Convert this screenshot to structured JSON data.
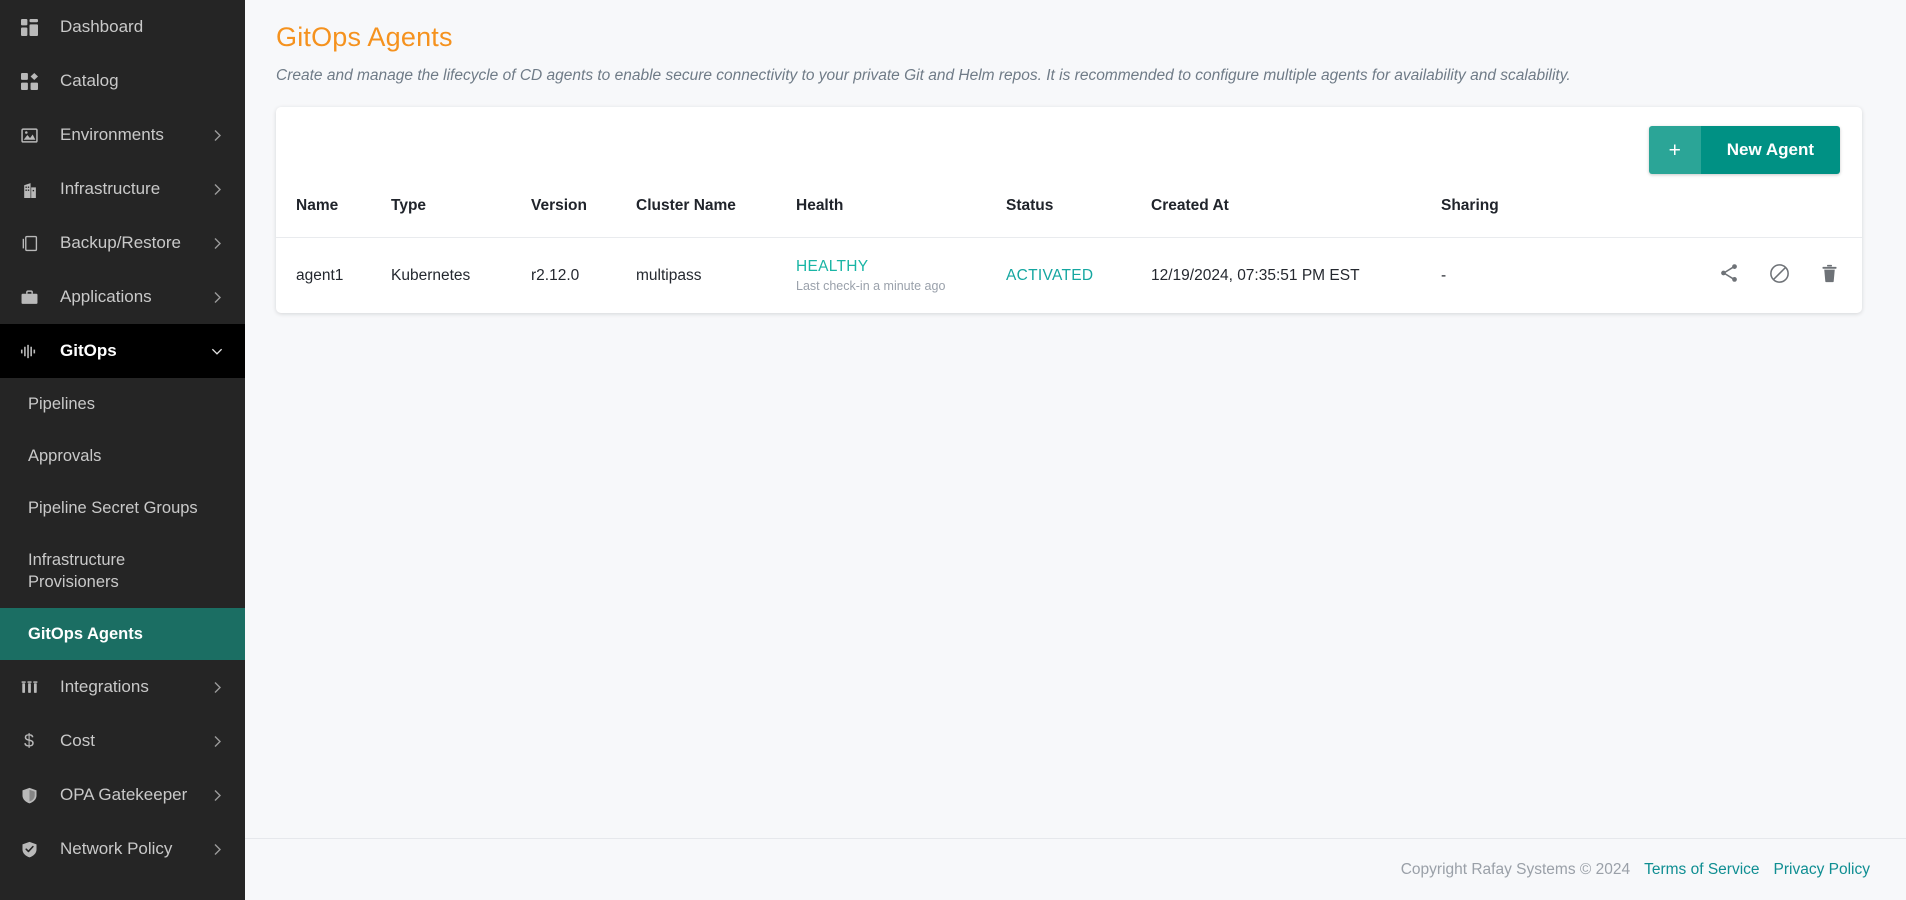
{
  "sidebar": {
    "items": [
      {
        "label": "Dashboard",
        "icon": "dashboard-icon",
        "has_chevron": false,
        "active": false
      },
      {
        "label": "Catalog",
        "icon": "catalog-icon",
        "has_chevron": false,
        "active": false
      },
      {
        "label": "Environments",
        "icon": "environments-icon",
        "has_chevron": true,
        "active": false
      },
      {
        "label": "Infrastructure",
        "icon": "infrastructure-icon",
        "has_chevron": true,
        "active": false
      },
      {
        "label": "Backup/Restore",
        "icon": "backup-restore-icon",
        "has_chevron": true,
        "active": false
      },
      {
        "label": "Applications",
        "icon": "applications-icon",
        "has_chevron": true,
        "active": false
      },
      {
        "label": "GitOps",
        "icon": "gitops-icon",
        "has_chevron": true,
        "active": true
      }
    ],
    "gitops_children": [
      {
        "label": "Pipelines",
        "active": false
      },
      {
        "label": "Approvals",
        "active": false
      },
      {
        "label": "Pipeline Secret Groups",
        "active": false
      },
      {
        "label": "Infrastructure Provisioners",
        "active": false
      },
      {
        "label": "GitOps Agents",
        "active": true
      }
    ],
    "items_after": [
      {
        "label": "Integrations",
        "icon": "integrations-icon",
        "has_chevron": true,
        "active": false
      },
      {
        "label": "Cost",
        "icon": "cost-icon",
        "has_chevron": true,
        "active": false
      },
      {
        "label": "OPA Gatekeeper",
        "icon": "opa-gatekeeper-icon",
        "has_chevron": true,
        "active": false
      },
      {
        "label": "Network Policy",
        "icon": "network-policy-icon",
        "has_chevron": true,
        "active": false
      }
    ],
    "colors": {
      "background": "#252525",
      "active_parent": "#000000",
      "active_child": "#1b6e63"
    }
  },
  "page": {
    "title": "GitOps Agents",
    "title_color": "#f5921e",
    "description": "Create and manage the lifecycle of CD agents to enable secure connectivity to your private Git and Helm repos. It is recommended to configure multiple agents for availability and scalability."
  },
  "toolbar": {
    "new_agent_plus": "+",
    "new_agent_label": "New Agent",
    "accent_color": "#009184"
  },
  "table": {
    "columns": [
      "Name",
      "Type",
      "Version",
      "Cluster Name",
      "Health",
      "Status",
      "Created At",
      "Sharing"
    ],
    "rows": [
      {
        "name": "agent1",
        "type": "Kubernetes",
        "version": "r2.12.0",
        "cluster_name": "multipass",
        "health": "HEALTHY",
        "health_detail": "Last check-in  a minute ago",
        "status": "ACTIVATED",
        "created_at": "12/19/2024, 07:35:51 PM EST",
        "sharing": "-",
        "actions": [
          "share-icon",
          "disable-icon",
          "delete-icon"
        ]
      }
    ],
    "health_color": "#19b5a5",
    "status_color": "#14a6a0"
  },
  "footer": {
    "copyright": "Copyright Rafay Systems © 2024",
    "terms_label": "Terms of Service",
    "privacy_label": "Privacy Policy",
    "link_color": "#0f8e92"
  }
}
